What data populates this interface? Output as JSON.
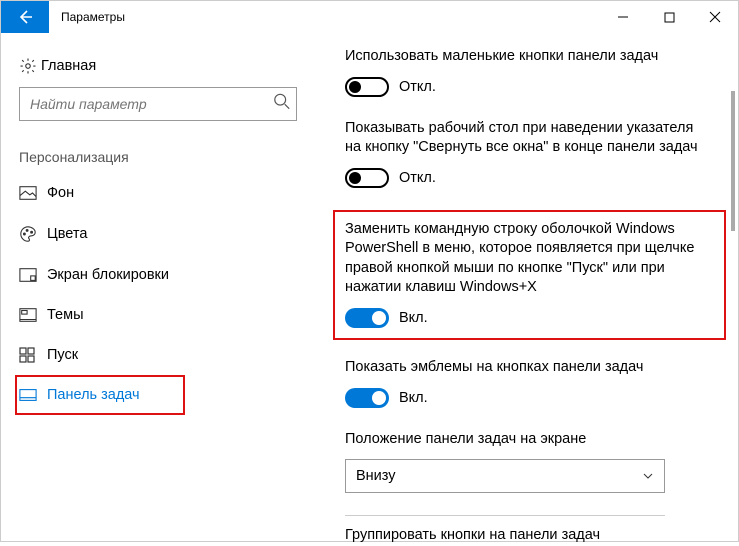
{
  "window": {
    "title": "Параметры"
  },
  "sidebar": {
    "home": "Главная",
    "search_placeholder": "Найти параметр",
    "category": "Персонализация",
    "items": [
      {
        "label": "Фон"
      },
      {
        "label": "Цвета"
      },
      {
        "label": "Экран блокировки"
      },
      {
        "label": "Темы"
      },
      {
        "label": "Пуск"
      },
      {
        "label": "Панель задач"
      }
    ]
  },
  "settings": [
    {
      "desc": "Использовать маленькие кнопки панели задач",
      "state": "off",
      "state_label": "Откл."
    },
    {
      "desc": "Показывать рабочий стол при наведении указателя на кнопку \"Свернуть все окна\" в конце панели задач",
      "state": "off",
      "state_label": "Откл."
    },
    {
      "desc": "Заменить командную строку оболочкой Windows PowerShell в меню, которое появляется при щелчке правой кнопкой мыши по кнопке \"Пуск\" или при нажатии клавиш Windows+X",
      "state": "on",
      "state_label": "Вкл.",
      "highlight": true
    },
    {
      "desc": "Показать эмблемы на кнопках панели задач",
      "state": "on",
      "state_label": "Вкл."
    }
  ],
  "position": {
    "label": "Положение панели задач на экране",
    "value": "Внизу"
  },
  "grouping": {
    "label": "Группировать кнопки на панели задач"
  }
}
